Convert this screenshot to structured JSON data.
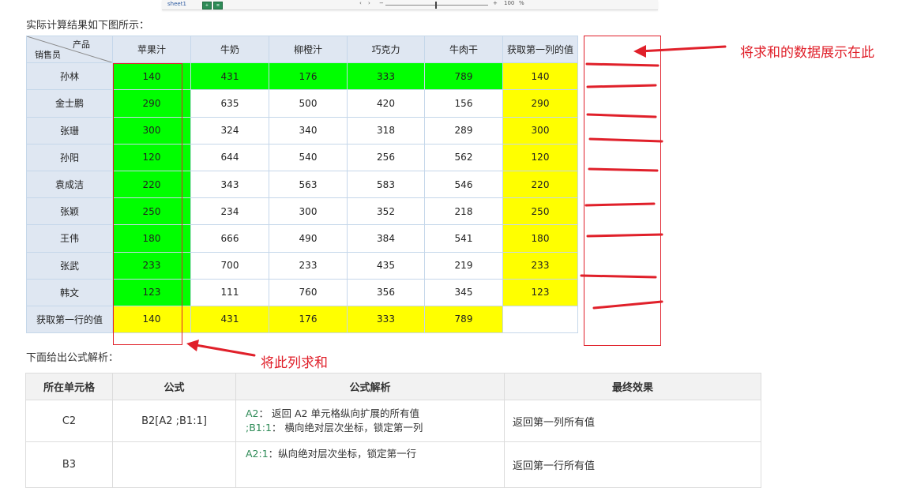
{
  "top_strip": {
    "sheet_tab": "sheet1",
    "zoom_text": "100"
  },
  "intro": "实际计算结果如下图所示：",
  "table": {
    "corner_top": "产品",
    "corner_bottom": "销售员",
    "headers": [
      "苹果汁",
      "牛奶",
      "柳橙汁",
      "巧克力",
      "牛肉干",
      "获取第一列的值"
    ],
    "rows": [
      {
        "name": "孙林",
        "values": [
          "140",
          "431",
          "176",
          "333",
          "789",
          "140"
        ]
      },
      {
        "name": "金士鹏",
        "values": [
          "290",
          "635",
          "500",
          "420",
          "156",
          "290"
        ]
      },
      {
        "name": "张珊",
        "values": [
          "300",
          "324",
          "340",
          "318",
          "289",
          "300"
        ]
      },
      {
        "name": "孙阳",
        "values": [
          "120",
          "644",
          "540",
          "256",
          "562",
          "120"
        ]
      },
      {
        "name": "袁成洁",
        "values": [
          "220",
          "343",
          "563",
          "583",
          "546",
          "220"
        ]
      },
      {
        "name": "张颖",
        "values": [
          "250",
          "234",
          "300",
          "352",
          "218",
          "250"
        ]
      },
      {
        "name": "王伟",
        "values": [
          "180",
          "666",
          "490",
          "384",
          "541",
          "180"
        ]
      },
      {
        "name": "张武",
        "values": [
          "233",
          "700",
          "233",
          "435",
          "219",
          "233"
        ]
      },
      {
        "name": "韩文",
        "values": [
          "123",
          "111",
          "760",
          "356",
          "345",
          "123"
        ]
      }
    ],
    "last_row": {
      "name": "获取第一行的值",
      "values": [
        "140",
        "431",
        "176",
        "333",
        "789",
        ""
      ]
    }
  },
  "annotations": {
    "right_note": "将求和的数据展示在此",
    "bottom_note": "将此列求和",
    "color": "#e0202a"
  },
  "below_text": "下面给出公式解析：",
  "formula_table": {
    "headers": [
      "所在单元格",
      "公式",
      "公式解析",
      "最终效果"
    ],
    "rows": [
      {
        "cell": "C2",
        "formula": "B2[A2 ;B1:1]",
        "explain_1_code": "A2",
        "explain_1_text": "： 返回 A2 单元格纵向扩展的所有值",
        "explain_2_code": ";B1:1",
        "explain_2_text": "： 横向绝对层次坐标，锁定第一列",
        "effect": "返回第一列所有值"
      },
      {
        "cell": "B3",
        "formula": "",
        "explain_1_code": "A2:1",
        "explain_1_text": "：纵向绝对层次坐标，锁定第一行",
        "explain_2_code": "",
        "explain_2_text": "",
        "effect": "返回第一行所有值"
      }
    ]
  },
  "colors": {
    "green": "#00ff00",
    "yellow": "#ffff00",
    "header": "#dfe7f2",
    "code": "#2e8b57"
  }
}
